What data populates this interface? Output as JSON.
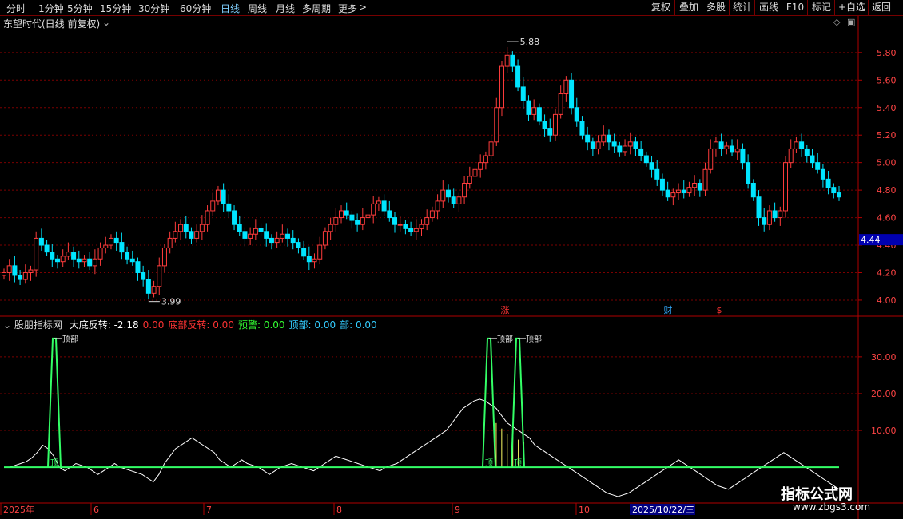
{
  "toolbar": {
    "left": [
      "分时",
      "1分钟",
      "5分钟",
      "15分钟",
      "30分钟",
      "60分钟",
      "日线",
      "周线",
      "月线",
      "多周期",
      "更多"
    ],
    "active_index": 6,
    "more_arrow": ">",
    "right": [
      "复权",
      "叠加",
      "多股",
      "统计",
      "画线",
      "F10",
      "标记",
      "+自选",
      "返回"
    ]
  },
  "stock_title": "东望时代(日线 前复权)",
  "price_axis": [
    "5.80",
    "5.60",
    "5.40",
    "5.20",
    "5.00",
    "4.80",
    "4.60",
    "4.40",
    "4.20",
    "4.00"
  ],
  "current_price": "4.44",
  "high_marker": "5.88",
  "low_marker": "3.99",
  "event_markers": [
    {
      "text": "涨",
      "color": "#ff3333"
    },
    {
      "text": "财",
      "color": "#33aaff"
    },
    {
      "text": "$",
      "color": "#ff3333"
    }
  ],
  "indicator": {
    "name": "股朋指标网",
    "items": [
      {
        "label": "大底反转:",
        "value": "-2.18",
        "color": "#ffffff"
      },
      {
        "label": "",
        "value": "0.00",
        "color": "#ff3333"
      },
      {
        "label": "底部反转:",
        "value": "0.00",
        "color": "#ff3333"
      },
      {
        "label": "预警:",
        "value": "0.00",
        "color": "#33ff33"
      },
      {
        "label": "顶部:",
        "value": "0.00",
        "color": "#33ccff"
      },
      {
        "label": "部:",
        "value": "0.00",
        "color": "#33ccff"
      }
    ],
    "axis": [
      "30.00",
      "20.00",
      "10.00"
    ],
    "signal_top": "顶部",
    "signal_bottom": "顶"
  },
  "date_axis": [
    "2025年",
    "6",
    "7",
    "8",
    "9",
    "10"
  ],
  "cursor_date": "2025/10/22/三",
  "watermark": {
    "line1": "指标公式网",
    "line2": "www.zbgs3.com"
  },
  "colors": {
    "up": "#ff3c3c",
    "down": "#00e5ff",
    "grid": "#7a0000",
    "axis": "#b00000",
    "signal": "#33ff66"
  },
  "chart_data": [
    {
      "type": "candlestick",
      "title": "东望时代(日线 前复权)",
      "y_ticks": [
        4.0,
        4.2,
        4.4,
        4.6,
        4.8,
        5.0,
        5.2,
        5.4,
        5.6,
        5.8
      ],
      "ylim": [
        3.93,
        5.95
      ],
      "x_labels": [
        "2025年",
        "6",
        "7",
        "8",
        "9",
        "10"
      ],
      "high": 5.88,
      "low": 3.99,
      "last": 4.44,
      "close": [
        4.2,
        4.25,
        4.18,
        4.15,
        4.2,
        4.22,
        4.45,
        4.4,
        4.35,
        4.3,
        4.28,
        4.32,
        4.35,
        4.3,
        4.28,
        4.3,
        4.25,
        4.3,
        4.38,
        4.4,
        4.45,
        4.42,
        4.35,
        4.3,
        4.28,
        4.2,
        4.15,
        4.05,
        4.1,
        4.25,
        4.38,
        4.45,
        4.5,
        4.55,
        4.5,
        4.45,
        4.5,
        4.55,
        4.65,
        4.72,
        4.8,
        4.7,
        4.65,
        4.55,
        4.5,
        4.45,
        4.48,
        4.52,
        4.5,
        4.45,
        4.42,
        4.45,
        4.48,
        4.45,
        4.42,
        4.38,
        4.32,
        4.28,
        4.3,
        4.4,
        4.5,
        4.55,
        4.6,
        4.65,
        4.62,
        4.58,
        4.55,
        4.6,
        4.62,
        4.7,
        4.72,
        4.65,
        4.6,
        4.55,
        4.55,
        4.52,
        4.5,
        4.52,
        4.55,
        4.6,
        4.65,
        4.72,
        4.8,
        4.75,
        4.7,
        4.75,
        4.85,
        4.9,
        4.95,
        5.0,
        5.05,
        5.15,
        5.4,
        5.7,
        5.78,
        5.7,
        5.55,
        5.45,
        5.35,
        5.4,
        5.3,
        5.25,
        5.2,
        5.35,
        5.5,
        5.6,
        5.4,
        5.3,
        5.2,
        5.15,
        5.1,
        5.15,
        5.2,
        5.15,
        5.12,
        5.08,
        5.12,
        5.15,
        5.1,
        5.05,
        5.0,
        4.95,
        4.88,
        4.8,
        4.75,
        4.78,
        4.8,
        4.78,
        4.82,
        4.85,
        4.8,
        4.95,
        5.1,
        5.15,
        5.1,
        5.12,
        5.08,
        5.1,
        5.0,
        4.85,
        4.75,
        4.6,
        4.55,
        4.65,
        4.6,
        4.65,
        5.0,
        5.1,
        5.15,
        5.1,
        5.05,
        5.0,
        4.95,
        4.88,
        4.82,
        4.78,
        4.75
      ]
    },
    {
      "type": "line",
      "title": "股朋指标网",
      "y_ticks": [
        10,
        20,
        30
      ],
      "ylim": [
        -8,
        38
      ],
      "series": [
        {
          "name": "大底反转",
          "values": [
            0,
            0,
            0.5,
            1,
            1.5,
            2.5,
            4,
            6,
            5,
            3,
            0,
            -1,
            0,
            1,
            0.5,
            0,
            -1,
            -2,
            -1,
            0,
            1,
            0,
            -0.5,
            -1,
            -1.5,
            -2,
            -3,
            -4,
            -2,
            1,
            3,
            5,
            6,
            7,
            8,
            7,
            6,
            5,
            4,
            2,
            1,
            0,
            1,
            2,
            1,
            0.5,
            0,
            -1,
            -2,
            -1,
            0,
            0.5,
            1,
            0.5,
            0,
            -0.5,
            -1,
            0,
            1,
            2,
            3,
            2.5,
            2,
            1.5,
            1,
            0.5,
            0,
            -0.5,
            -1,
            0,
            0.5,
            1,
            2,
            3,
            4,
            5,
            6,
            7,
            8,
            9,
            10,
            12,
            14,
            16,
            17,
            18,
            18.5,
            18,
            17,
            16,
            14,
            12,
            11,
            10,
            9,
            8,
            6,
            5,
            4,
            3,
            2,
            1,
            0,
            -1,
            -2,
            -3,
            -4,
            -5,
            -6,
            -7,
            -7.5,
            -8,
            -7.5,
            -7,
            -6,
            -5,
            -4,
            -3,
            -2,
            -1,
            0,
            1,
            2,
            1,
            0,
            -1,
            -2,
            -3,
            -4,
            -5,
            -5.5,
            -6,
            -5,
            -4,
            -3,
            -2,
            -1,
            0,
            1,
            2,
            3,
            4,
            3,
            2,
            1,
            0,
            -1,
            -2,
            -3,
            -4,
            -5,
            -6
          ]
        },
        {
          "name": "顶部",
          "values": [
            0
          ]
        }
      ]
    }
  ]
}
